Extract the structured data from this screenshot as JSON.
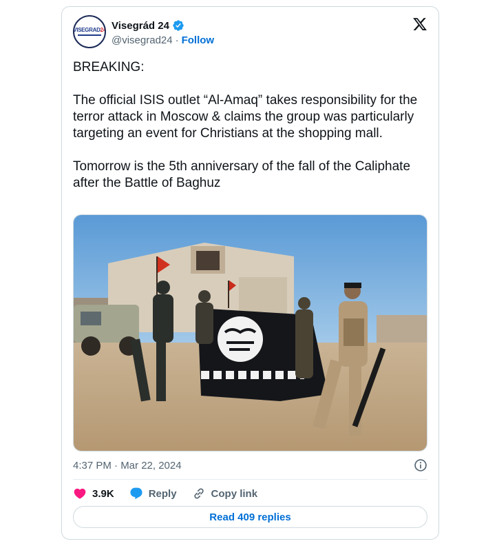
{
  "author": {
    "display_name": "Visegrád 24",
    "handle": "@visegrad24",
    "separator": "·",
    "follow_label": "Follow",
    "avatar_text": "VISEGRAD",
    "avatar_text_accent": "24"
  },
  "tweet": {
    "paragraphs": [
      "BREAKING:",
      "The official ISIS outlet “Al-Amaq” takes responsibility for the terror attack in Moscow & claims the group was particularly targeting an event for Christians at the shopping mall.",
      "Tomorrow is the 5th anniversary of the fall of the Caliphate after the Battle of Baghuz"
    ],
    "timestamp": "4:37 PM · Mar 22, 2024"
  },
  "actions": {
    "like_count": "3.9K",
    "reply_label": "Reply",
    "copy_link_label": "Copy link",
    "read_replies_label": "Read 409 replies"
  },
  "colors": {
    "link_blue": "#006fd6",
    "verified_blue": "#1d9bf0",
    "like_pink": "#f91880",
    "secondary_text": "#536471",
    "border": "#cfd9de"
  },
  "icons": [
    "verified-badge-icon",
    "x-logo-icon",
    "info-icon",
    "heart-icon",
    "reply-bubble-icon",
    "link-icon"
  ]
}
